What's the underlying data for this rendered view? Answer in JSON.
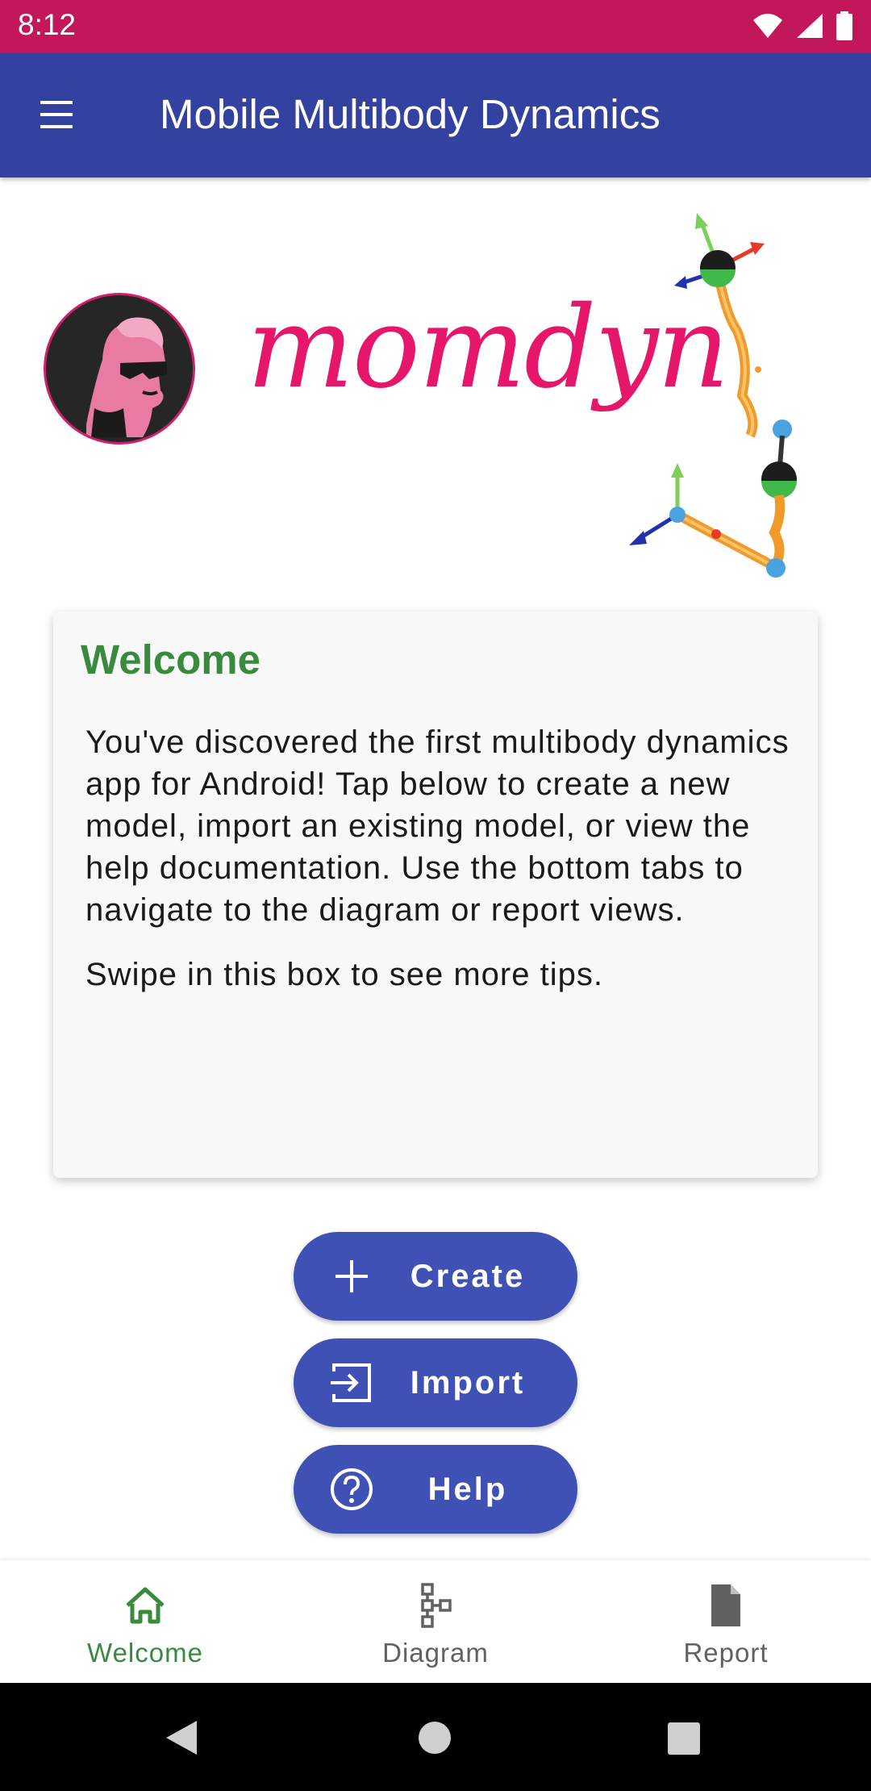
{
  "status_bar": {
    "time": "8:12"
  },
  "app_bar": {
    "title": "Mobile Multibody Dynamics",
    "menu_icon": "hamburger-menu-icon"
  },
  "logo": {
    "text": "momdyn"
  },
  "welcome_card": {
    "title": "Welcome",
    "paragraph1": "You've discovered the first multibody dynamics app for Android! Tap below to create a new model, import an existing model, or view the help documentation. Use the bottom tabs to navigate to the diagram or report views.",
    "paragraph2": "Swipe in this box to see more tips."
  },
  "actions": {
    "create": {
      "label": "Create",
      "icon": "plus-icon"
    },
    "import": {
      "label": "Import",
      "icon": "import-icon"
    },
    "help": {
      "label": "Help",
      "icon": "help-icon"
    }
  },
  "bottom_nav": {
    "items": [
      {
        "label": "Welcome",
        "icon": "home-icon",
        "active": true
      },
      {
        "label": "Diagram",
        "icon": "diagram-icon",
        "active": false
      },
      {
        "label": "Report",
        "icon": "report-icon",
        "active": false
      }
    ]
  },
  "colors": {
    "status_bar": "#c2185b",
    "app_bar": "#3341a1",
    "accent": "#3f51b5",
    "welcome_green": "#3a8a3e",
    "logo_pink": "#e6176b"
  }
}
